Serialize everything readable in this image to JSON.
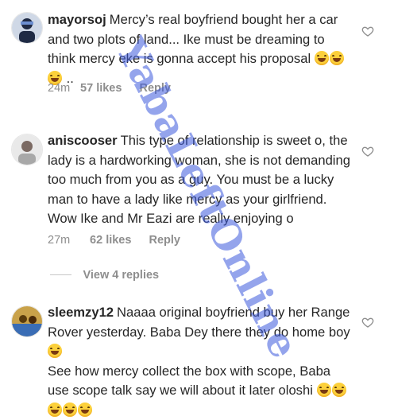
{
  "comments": [
    {
      "username": "mayorsoj",
      "text": "Mercy’s real boyfriend bought her a car and two plots of land... Ike must be dreaming to think mercy eke is gonna accept his proposal",
      "trailing": " ..",
      "emojis": [
        "face-with-tears-of-joy",
        "loudly-crying-face",
        "rolling-on-floor-laughing"
      ],
      "time": "24m",
      "likes": "57 likes",
      "reply": "Reply",
      "avatar_colors": [
        "#1f2a44",
        "#6d8fd1"
      ]
    },
    {
      "username": "aniscooser",
      "text": "This type of relationship is sweet o, the lady is a hardworking woman, she is not demanding too much from you as a guy. You must be a lucky man to have a lady like mercy as your girlfriend. Wow Ike and Mr Eazi are really enjoying o",
      "trailing": "",
      "emojis": [],
      "time": "27m",
      "likes": "62 likes",
      "reply": "Reply",
      "avatar_colors": [
        "#e9e9e9",
        "#7b6a63"
      ]
    },
    {
      "username": "sleemzy12",
      "text": "Naaaa original boyfriend buy her Range Rover yesterday. Baba Dey there they do home boy",
      "trailing": "",
      "emojis": [
        "face-with-tears-of-joy"
      ],
      "text2": "See how mercy collect the box with scope, Baba use scope talk say we will about it later oloshi",
      "emojis2": [
        "face-with-tears-of-joy",
        "face-with-tears-of-joy",
        "face-with-tears-of-joy",
        "face-with-tears-of-joy",
        "face-with-tears-of-joy"
      ],
      "avatar_colors": [
        "#c9a24a",
        "#3a6db5"
      ]
    }
  ],
  "view_replies": "View 4 replies",
  "watermark": "YabaLeftOnline",
  "colors": {
    "text": "#262626",
    "meta": "#8e8e8e",
    "divider": "#c7c7c7",
    "watermark": "#3c5adc"
  }
}
